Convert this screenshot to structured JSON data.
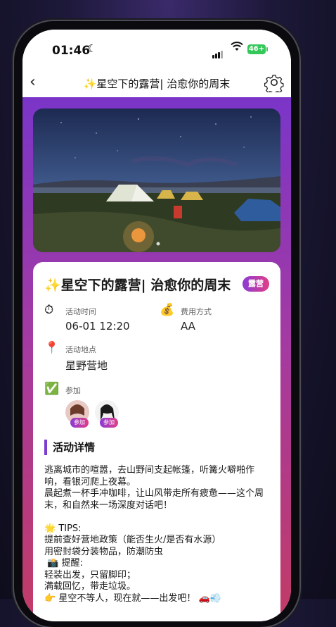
{
  "status_bar": {
    "time": "01:46",
    "battery": "46+"
  },
  "nav": {
    "back_label": "‹",
    "title": "✨星空下的露营| 治愈你的周末"
  },
  "event": {
    "title": "✨星空下的露营| 治愈你的周末",
    "badge": "露营",
    "time_label": "活动时间",
    "time_value": "06-01 12:20",
    "fee_label": "费用方式",
    "fee_value": "AA",
    "location_label": "活动地点",
    "location_value": "星野营地",
    "participants_label": "参加",
    "participants": [
      {
        "tag": "参加"
      },
      {
        "tag": "参加"
      }
    ],
    "details_heading": "活动详情",
    "details_text": "逃离城市的喧嚣，去山野间支起帐篷，听篝火噼啪作响，看银河爬上夜幕。\n晨起煮一杯手冲咖啡，让山风带走所有疲惫——这个周末，和自然来一场深度对话吧！\n\n🌟 TIPS:\n提前查好营地政策（能否生火/是否有水源）\n用密封袋分装物品，防潮防虫\n 📸 提醒:\n轻装出发，只留脚印；\n满载回忆，带走垃圾。\n👉 星空不等人，现在就——出发吧！ 🚗💨"
  },
  "icons": {
    "clock": "⏱",
    "money": "💰",
    "pin": "📍",
    "check": "✅"
  }
}
